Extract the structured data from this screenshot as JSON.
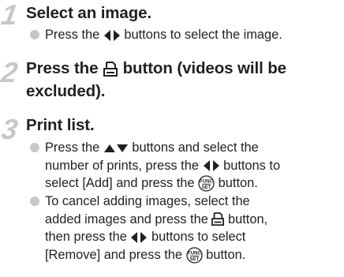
{
  "steps": [
    {
      "number": "1",
      "title": "Select an image.",
      "bullets": [
        {
          "line1_a": "Press the",
          "line1_b": "buttons to select the image."
        }
      ]
    },
    {
      "number": "2",
      "title_a": "Press the",
      "title_b": "button (videos will be",
      "title_line2": "excluded)."
    },
    {
      "number": "3",
      "title": "Print list.",
      "bullets": [
        {
          "line1_a": "Press the",
          "line1_b": "buttons and select the",
          "line2_a": "number of prints, press the",
          "line2_b": "buttons to",
          "line3_a": "select [Add] and press the",
          "line3_b": "button."
        },
        {
          "line1": "To cancel adding images, select the",
          "line2_a": "added images and press the",
          "line2_b": "button,",
          "line3_a": "then press the",
          "line3_b": "buttons to select",
          "line4_a": "[Remove] and press the",
          "line4_b": "button."
        }
      ]
    }
  ],
  "icons": {
    "left_right": "left-right-arrow-buttons",
    "up_down": "up-down-arrow-buttons",
    "print": "print-button",
    "func_set": "func-set-button",
    "func_text": "FUNC",
    "set_text": "SET"
  },
  "colors": {
    "text": "#231f20",
    "accent_gray": "#c8c8c8"
  }
}
